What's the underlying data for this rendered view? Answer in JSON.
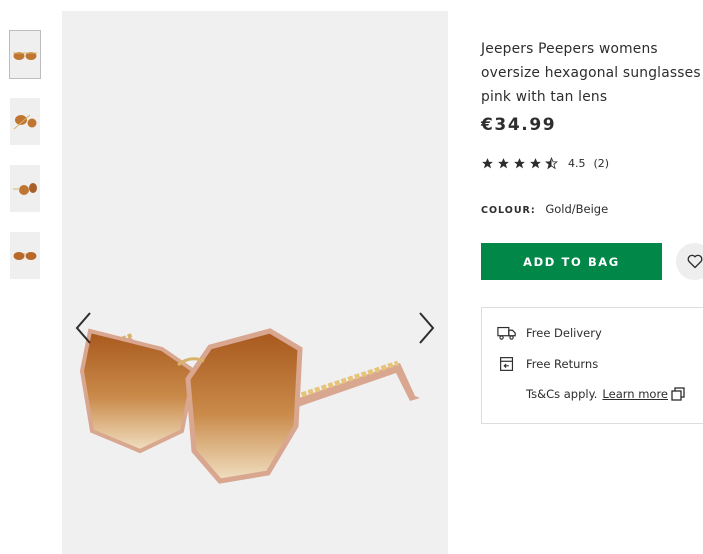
{
  "product": {
    "title_line1": "Jeepers Peepers womens",
    "title_line2": "oversize hexagonal sunglasses in",
    "title_line3": "pink with tan lens",
    "price": "€34.99",
    "rating": {
      "value": "4.5",
      "count": "(2)",
      "stars_filled": 4.5,
      "stars_total": 5
    },
    "colour_label": "COLOUR:",
    "colour_value": "Gold/Beige"
  },
  "actions": {
    "add_to_bag": "ADD TO BAG",
    "save_icon": "heart-icon"
  },
  "delivery": {
    "free_delivery": "Free Delivery",
    "free_returns": "Free Returns",
    "tcs_text": "Ts&Cs apply.",
    "learn_more": "Learn more"
  },
  "gallery": {
    "thumbnail_count": 4,
    "prev_icon": "chevron-left-icon",
    "next_icon": "chevron-right-icon"
  },
  "colors": {
    "accent_green": "#018849",
    "lens_tan": "#b8692a",
    "frame_gold": "#d8b46a",
    "frame_pink": "#d9a68f"
  }
}
